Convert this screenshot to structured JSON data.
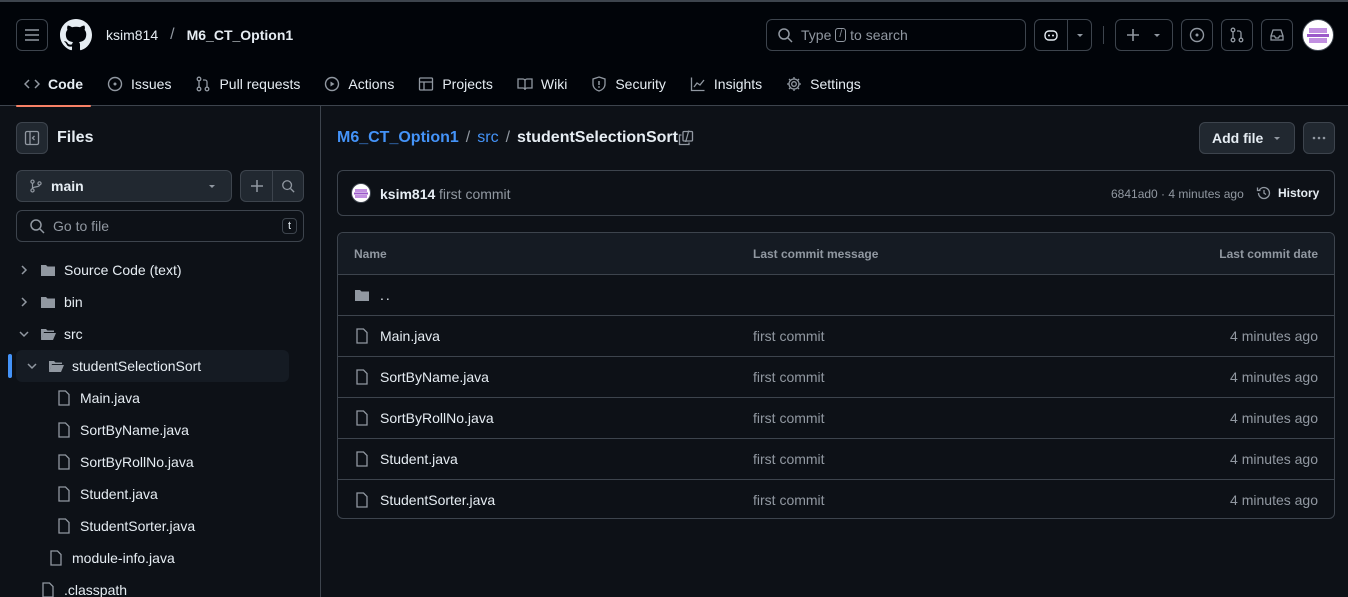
{
  "header": {
    "owner": "ksim814",
    "repo": "M6_CT_Option1",
    "search_prefix": "Type",
    "search_key": "/",
    "search_suffix": "to search"
  },
  "nav": [
    {
      "label": "Code",
      "icon": "code-icon",
      "active": true
    },
    {
      "label": "Issues",
      "icon": "issue-icon"
    },
    {
      "label": "Pull requests",
      "icon": "pull-request-icon"
    },
    {
      "label": "Actions",
      "icon": "play-icon"
    },
    {
      "label": "Projects",
      "icon": "table-icon"
    },
    {
      "label": "Wiki",
      "icon": "book-icon"
    },
    {
      "label": "Security",
      "icon": "shield-icon"
    },
    {
      "label": "Insights",
      "icon": "graph-icon"
    },
    {
      "label": "Settings",
      "icon": "gear-icon"
    }
  ],
  "sidebar": {
    "title": "Files",
    "branch": "main",
    "goto_placeholder": "Go to file",
    "goto_key": "t",
    "tree": [
      {
        "label": "Source Code (text)",
        "type": "folder",
        "depth": 0,
        "expanded": false
      },
      {
        "label": "bin",
        "type": "folder",
        "depth": 0,
        "expanded": false
      },
      {
        "label": "src",
        "type": "folder",
        "depth": 0,
        "expanded": true
      },
      {
        "label": "studentSelectionSort",
        "type": "folder-open",
        "depth": 1,
        "expanded": true,
        "selected": true
      },
      {
        "label": "Main.java",
        "type": "file",
        "depth": 2
      },
      {
        "label": "SortByName.java",
        "type": "file",
        "depth": 2
      },
      {
        "label": "SortByRollNo.java",
        "type": "file",
        "depth": 2
      },
      {
        "label": "Student.java",
        "type": "file",
        "depth": 2
      },
      {
        "label": "StudentSorter.java",
        "type": "file",
        "depth": 2
      },
      {
        "label": "module-info.java",
        "type": "file",
        "depth": 1
      },
      {
        "label": ".classpath",
        "type": "file",
        "depth": 0
      }
    ]
  },
  "main": {
    "breadcrumb": {
      "repo": "M6_CT_Option1",
      "sep": "/",
      "dir": "src",
      "current": "studentSelectionSort"
    },
    "add_file_label": "Add file",
    "commit": {
      "author": "ksim814",
      "message": "first commit",
      "hash_age": "6841ad0 · 4 minutes ago",
      "history_label": "History"
    },
    "table": {
      "columns": [
        "Name",
        "Last commit message",
        "Last commit date"
      ],
      "parent": "..",
      "rows": [
        {
          "name": "Main.java",
          "message": "first commit",
          "date": "4 minutes ago"
        },
        {
          "name": "SortByName.java",
          "message": "first commit",
          "date": "4 minutes ago"
        },
        {
          "name": "SortByRollNo.java",
          "message": "first commit",
          "date": "4 minutes ago"
        },
        {
          "name": "Student.java",
          "message": "first commit",
          "date": "4 minutes ago"
        },
        {
          "name": "StudentSorter.java",
          "message": "first commit",
          "date": "4 minutes ago"
        }
      ]
    }
  },
  "colors": {
    "background": "#0d1117",
    "header": "#010409",
    "border": "#3d444d",
    "accent_link": "#4493f8",
    "active_underline": "#f78166",
    "muted": "#9198a1"
  }
}
